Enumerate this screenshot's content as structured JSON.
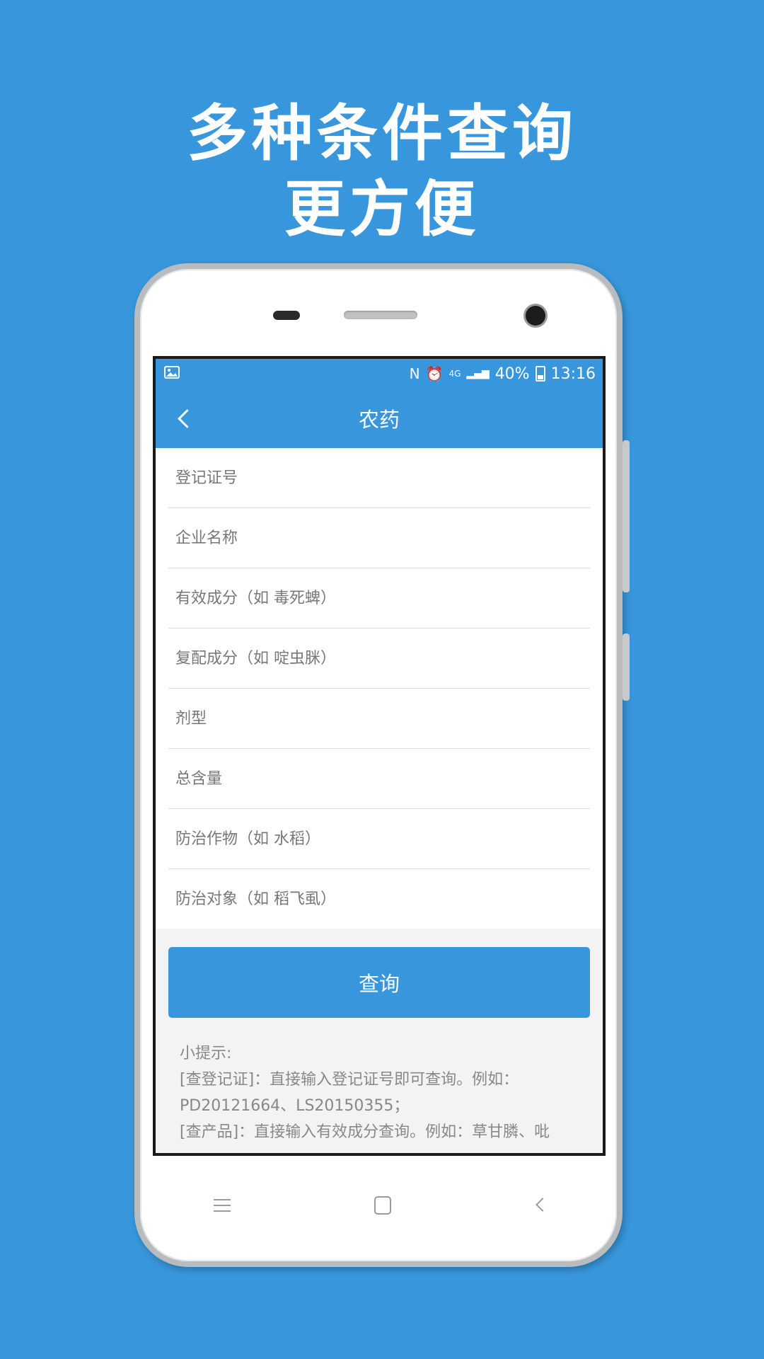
{
  "promo": {
    "line1": "多种条件查询",
    "line2": "更方便"
  },
  "status_bar": {
    "image_icon": "image-icon",
    "nfc_icon": "nfc-icon",
    "nfc_glyph": "N",
    "alarm_icon": "alarm-icon",
    "alarm_glyph": "⏰",
    "network": "4G",
    "signal_icon": "signal-icon",
    "signal_glyph": "▂▄▆",
    "battery_percent": "40%",
    "time": "13:16"
  },
  "header": {
    "back_icon": "chevron-left-icon",
    "title": "农药"
  },
  "form": {
    "fields": [
      {
        "placeholder": "登记证号",
        "value": ""
      },
      {
        "placeholder": "企业名称",
        "value": ""
      },
      {
        "placeholder": "有效成分（如 毒死蜱）",
        "value": ""
      },
      {
        "placeholder": "复配成分（如 啶虫脒）",
        "value": ""
      },
      {
        "placeholder": "剂型",
        "value": ""
      },
      {
        "placeholder": "总含量",
        "value": ""
      },
      {
        "placeholder": "防治作物（如 水稻）",
        "value": ""
      },
      {
        "placeholder": "防治对象（如 稻飞虱）",
        "value": ""
      }
    ],
    "submit_label": "查询"
  },
  "tips": {
    "title": "小提示:",
    "lines": [
      "[查登记证]：直接输入登记证号即可查询。例如：",
      "PD20121664、LS20150355；",
      "[查产品]：直接输入有效成分查询。例如：草甘膦、吡"
    ]
  },
  "softkeys": {
    "menu": "menu-icon",
    "home": "home-icon",
    "back": "back-icon"
  },
  "colors": {
    "background": "#3897dc",
    "accent": "#3796dc",
    "tip_text": "#888888"
  }
}
